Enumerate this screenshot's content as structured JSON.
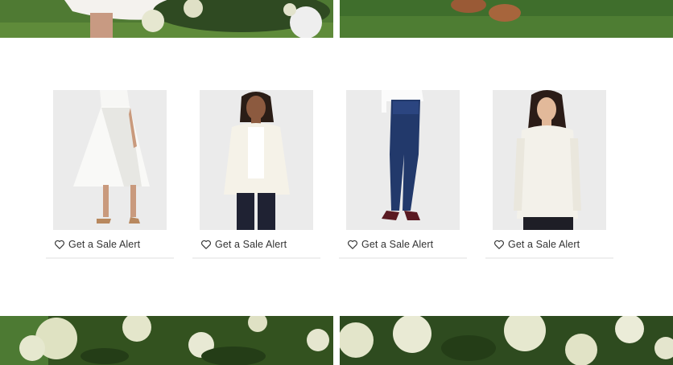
{
  "products": [
    {
      "image_icon": "white-midi-skirt-model-photo",
      "sale_alert_label": "Get a Sale Alert"
    },
    {
      "image_icon": "ivory-blazer-model-photo",
      "sale_alert_label": "Get a Sale Alert"
    },
    {
      "image_icon": "dark-skinny-jeans-model-photo",
      "sale_alert_label": "Get a Sale Alert"
    },
    {
      "image_icon": "ivory-sweater-model-photo",
      "sale_alert_label": "Get a Sale Alert"
    }
  ],
  "banners": {
    "top_left_icon": "white-dress-garden-photo",
    "top_right_icon": "sandals-on-grass-photo",
    "bottom_left_icon": "hydrangea-bushes-photo",
    "bottom_right_icon": "hydrangea-flowers-photo"
  },
  "colors": {
    "grass": "#3d6b2c",
    "foliage": "#2f4a22",
    "flowers": "#e9ead6",
    "image_bg": "#ededed",
    "text": "#333333",
    "divider": "#efefef"
  }
}
